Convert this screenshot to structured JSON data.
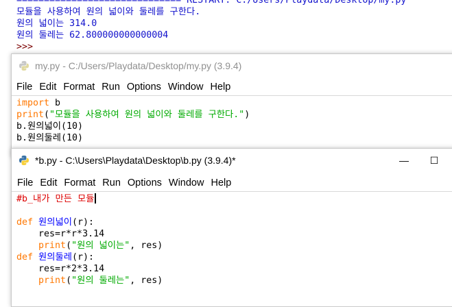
{
  "shell": {
    "line0": "============================== RESTART: C:/Users/Playdata/Desktop/my.py",
    "line1": "모듈을 사용하여 원의 넓이와 둘레를 구한다.",
    "line2": "원의 넓이는 314.0",
    "line3": "원의 둘레는 62.800000000000004",
    "prompt": ">>>"
  },
  "window1": {
    "title": "my.py - C:/Users/Playdata/Desktop/my.py (3.9.4)",
    "menu": [
      "File",
      "Edit",
      "Format",
      "Run",
      "Options",
      "Window",
      "Help"
    ],
    "code": {
      "l1_kw": "import",
      "l1_rest": " b",
      "l2_fn": "print",
      "l2_open": "(",
      "l2_str": "\"모듈을 사용하여 원의 넓이와 둘레를 구한다.\"",
      "l2_close": ")",
      "l3": "b.원의넓이(10)",
      "l4": "b.원의둘레(10)"
    }
  },
  "window2": {
    "title": "*b.py - C:\\Users\\Playdata\\Desktop\\b.py (3.9.4)*",
    "menu": [
      "File",
      "Edit",
      "Format",
      "Run",
      "Options",
      "Window",
      "Help"
    ],
    "buttons": {
      "minimize": "—",
      "maximize": "☐"
    },
    "code": {
      "comment": "#b_내가 만든 모듈",
      "def1_kw": "def",
      "def1_name": " 원의넓이",
      "def1_rest": "(r):",
      "body1": "    res=r*r*3.14",
      "print1_pad": "    ",
      "print1_fn": "print",
      "print1_open": "(",
      "print1_str": "\"원의 넓이는\"",
      "print1_rest": ", res)",
      "def2_kw": "def",
      "def2_name": " 원의둘레",
      "def2_rest": "(r):",
      "body2": "    res=r*2*3.14",
      "print2_pad": "    ",
      "print2_fn": "print",
      "print2_open": "(",
      "print2_str": "\"원의 둘레는\"",
      "print2_rest": ", res)"
    }
  },
  "colors": {
    "keyword": "#ff7700",
    "string": "#00aa00",
    "defname": "#0000ff",
    "comment": "#dd0000",
    "shell_output": "#1111cc"
  }
}
